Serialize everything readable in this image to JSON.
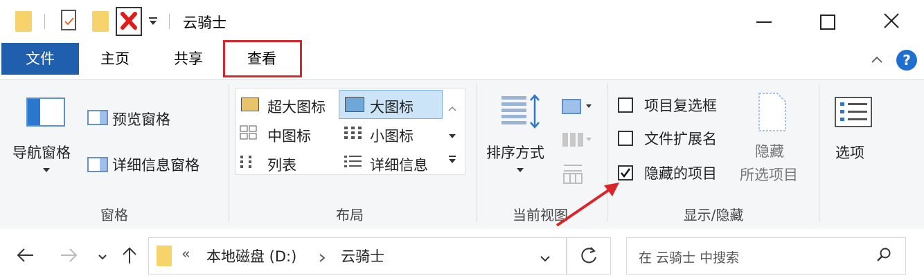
{
  "window": {
    "title": "云骑士",
    "controls": {
      "minimize": "—",
      "maximize": "☐",
      "close": "✕"
    }
  },
  "tabs": {
    "file": "文件",
    "home": "主页",
    "share": "共享",
    "view": "查看"
  },
  "ribbon": {
    "panes": {
      "nav_pane": "导航窗格",
      "preview_pane": "预览窗格",
      "details_pane": "详细信息窗格",
      "group_label": "窗格"
    },
    "layout": {
      "items": [
        "超大图标",
        "大图标",
        "中图标",
        "小图标",
        "列表",
        "详细信息"
      ],
      "selected": "大图标",
      "group_label": "布局"
    },
    "current_view": {
      "sort_by": "排序方式",
      "group_label": "当前视图"
    },
    "show_hide": {
      "item_checkboxes": {
        "label": "项目复选框",
        "checked": false
      },
      "file_extensions": {
        "label": "文件扩展名",
        "checked": false
      },
      "hidden_items": {
        "label": "隐藏的项目",
        "checked": true
      },
      "hide_selected_line1": "隐藏",
      "hide_selected_line2": "所选项目",
      "group_label": "显示/隐藏"
    },
    "options": "选项"
  },
  "address": {
    "overflow": "«",
    "crumbs": [
      "本地磁盘 (D:)",
      "云骑士"
    ],
    "search_placeholder": "在 云骑士 中搜索"
  },
  "colors": {
    "file_tab": "#1f5fad",
    "highlight_box": "#d9262a",
    "arrow": "#d9262a",
    "selected_layout": "#cce4f7",
    "help": "#1f6fd1"
  }
}
